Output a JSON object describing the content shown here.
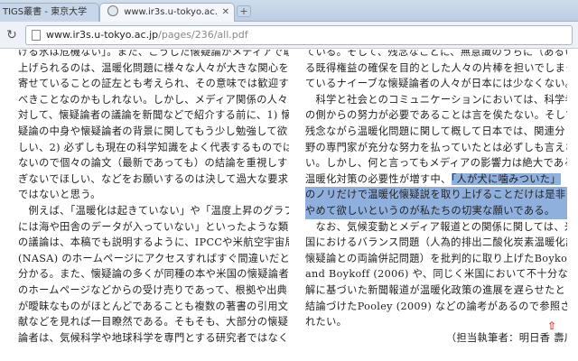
{
  "tabs": [
    {
      "label": "TIGS叢書 - 東京大学",
      "active": false
    },
    {
      "label": "www.ir3s.u-tokyo.ac.jp/pages",
      "active": true
    }
  ],
  "new_tab_label": "+",
  "address_bar": {
    "host": "www.ir3s.u-tokyo.ac.jp",
    "path": "/pages/236/all.pdf"
  },
  "document": {
    "left_column": [
      "ける氷は危機ない」。また、こうした懐疑論がメディアで取り",
      "上げられるのは、温暖化問題に様々な人々が大きな関心を",
      "寄せていることの証左とも考えられ、その意味では歓迎す",
      "べきことなのかもしれない。しかし、メディア関係の人々に",
      "対して、懐疑論者の議論を新聞などで紹介する前に、1) 懐",
      "疑論の中身や懐疑論者の背景に関してもう少し勉強して欲",
      "しい、2) 必ずしも現在の科学知識をよく代表するものでは",
      "ないので個々の論文（最新であっても）の結論を重視しす",
      "ぎないでほしい、などをお願いするのは決して過大な要求",
      "ではないと思う。",
      "　例えば、「温暖化は起きていない」や「温度上昇のグラフ",
      "には海や田舎のデータが入っていない」といったような類",
      "の議論は、本稿でも説明するように、IPCCや米航空宇宙局",
      "(NASA) のホームページにアクセスすればすぐ間違いだと",
      "分かる。また、懐疑論の多くが同種の本や米国の懐疑論者",
      "のホームページなどからの受け売りであって、根拠や出典",
      "が曖昧なものがほとんどであることも複数の著書の引用文",
      "献などを見れば一目瞭然である。そもそも、大部分の懐疑",
      "論者は、気候科学や地球科学を専門とする研究者ではなく、"
    ],
    "right_column": [
      "ている。そして、残念なことに、無意識のうちに（あるいは",
      "る既得権益の確保を目的とした人々の片棒を担いでしまっ",
      "ているナイーブな懐疑論者の人々が日本には少なくない。",
      "　科学と社会とのコミュニケーションにおいては、科学者",
      "の側からの努力が必要であることは言を俟たない。そして、",
      "残念ながら温暖化問題に関して概して日本では、関連分",
      "野の専門家が充分な努力を払っていたとは必ずしも言えな",
      "い。しかし、何と言ってもメディアの影響力は絶大である。",
      "温暖化対策の必要性が増す中、「人が犬に噛みついた」",
      "のノリだけで温暖化懐疑説を取り上げることだけは是非とも",
      "やめて欲しいというのが私たちの切実な願いである。",
      "　なお、気候変動とメディア報道との関係に関しては、米",
      "国におけるバランス問題（人為的排出二酸化炭素温暖化説",
      "懐疑論との両論併記問題）を批判的に取り上げたBoykoff",
      "and Boykoff (2006) や、同じく米国において不十分な理",
      "解に基づいた新聞報道が温暖化政策の進展を遅らせたと",
      "結論づけたPooley (2009) などの論考があるので参照さ",
      "れたい。",
      "　　　　　　　　　　　　　　（担当執筆者：明日香 壽川）"
    ],
    "up_arrow": "⇧"
  }
}
